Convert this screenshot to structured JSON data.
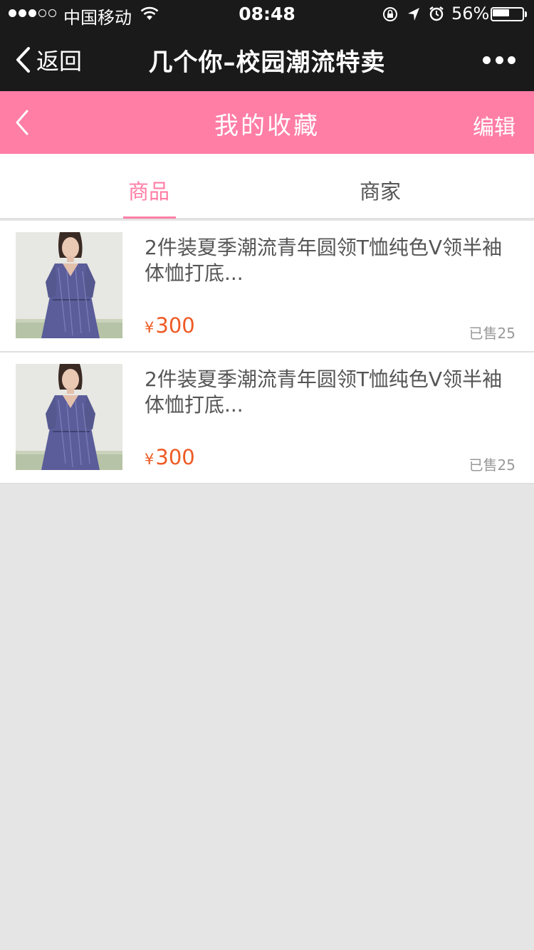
{
  "status_bar": {
    "carrier": "中国移动",
    "time": "08:48",
    "battery_percent": "56%",
    "battery_level": 0.56,
    "signal_bars_filled": 3,
    "signal_bars_total": 5,
    "icons": [
      "wifi-icon",
      "orientation-lock-icon",
      "location-arrow-icon",
      "alarm-icon",
      "battery-icon"
    ]
  },
  "wechat_nav": {
    "back_label": "返回",
    "title": "几个你–校园潮流特卖",
    "more_icon": "more-dots-icon"
  },
  "header": {
    "title": "我的收藏",
    "edit_label": "编辑",
    "back_icon": "chevron-left-icon",
    "background_color": "#ff7ea6"
  },
  "tabs": {
    "items": [
      {
        "label": "商品",
        "active": true
      },
      {
        "label": "商家",
        "active": false
      }
    ],
    "active_color": "#ff7ea6"
  },
  "products": [
    {
      "name": "2件装夏季潮流青年圆领T恤纯色V领半袖体恤打底...",
      "currency": "¥",
      "price": "300",
      "sold": "已售25"
    },
    {
      "name": "2件装夏季潮流青年圆领T恤纯色V领半袖体恤打底...",
      "currency": "¥",
      "price": "300",
      "sold": "已售25"
    }
  ],
  "colors": {
    "price": "#ee5a24",
    "page_background": "#e5e5e5"
  }
}
